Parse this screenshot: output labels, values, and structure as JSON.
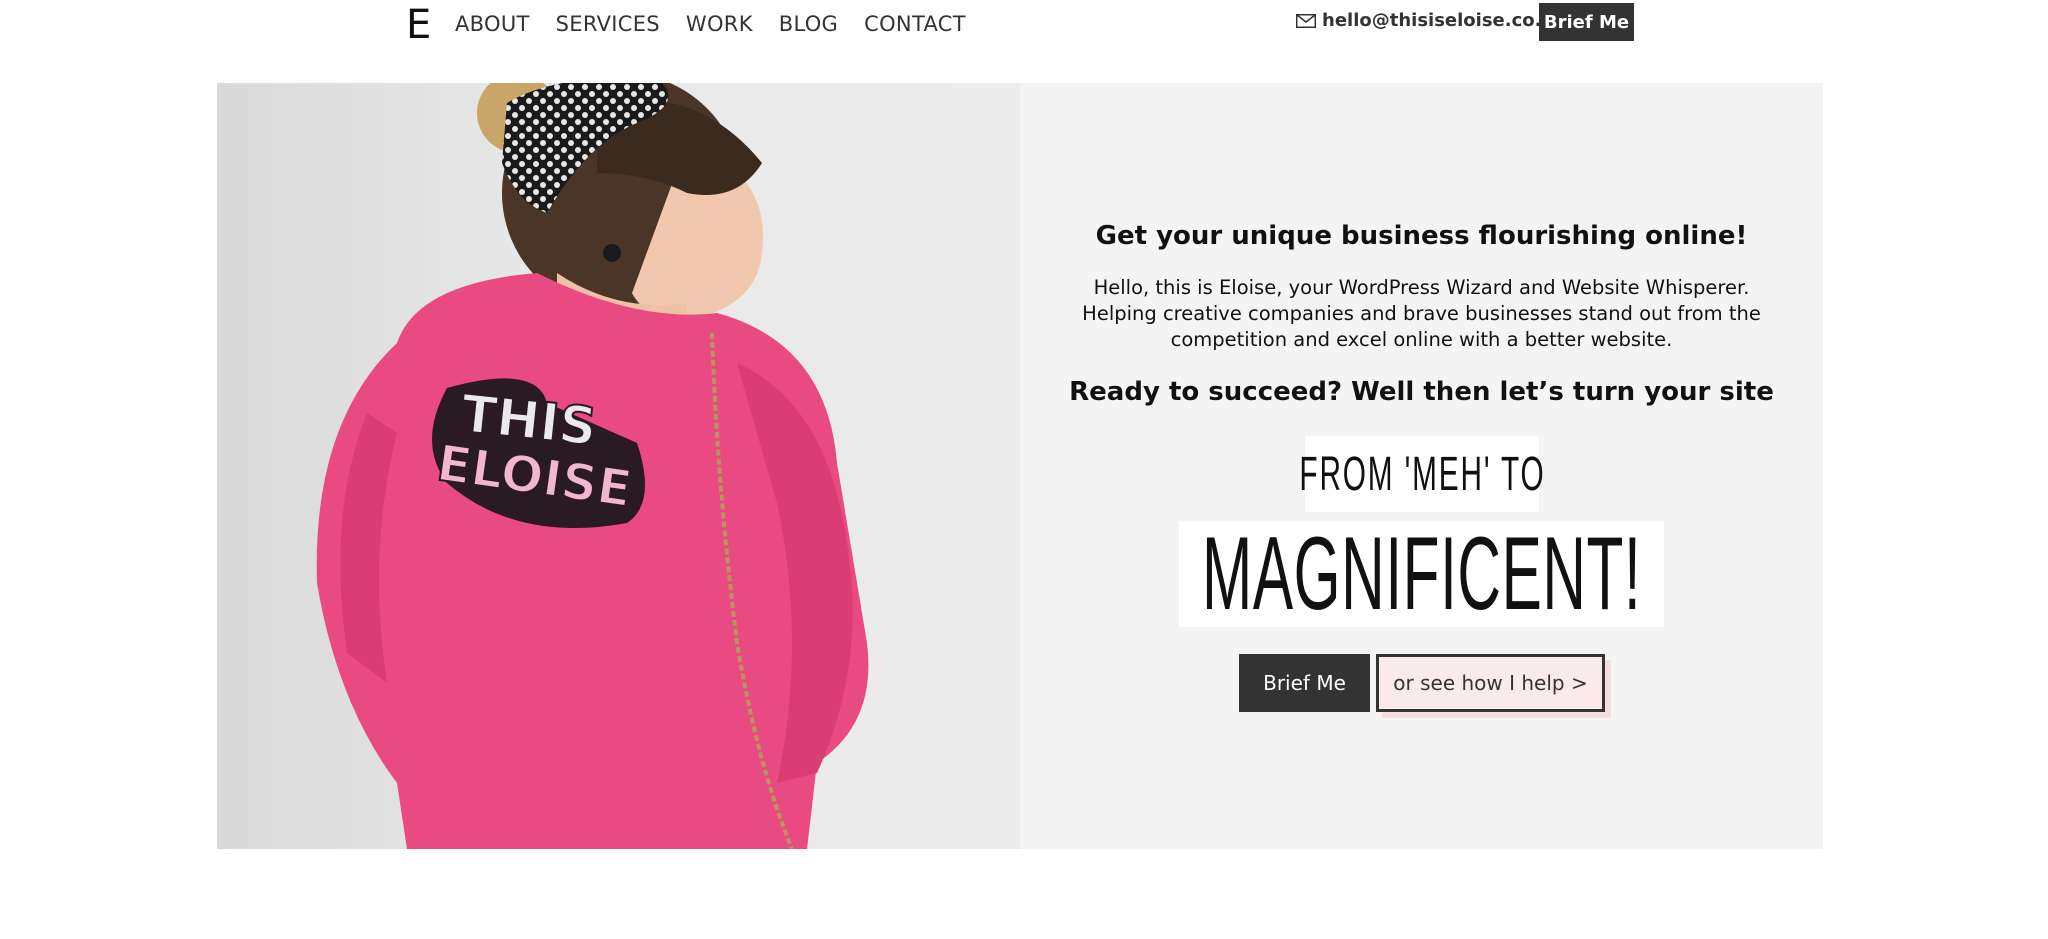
{
  "header": {
    "logo": "E",
    "nav": [
      "ABOUT",
      "SERVICES",
      "WORK",
      "BLOG",
      "CONTACT"
    ],
    "email": "hello@thisiseloise.co.uk",
    "brief_label": "Brief Me"
  },
  "hero": {
    "tagline": "Get your unique business flourishing online!",
    "intro": "Hello, this is Eloise, your WordPress Wizard and Website Whisperer. Helping creative companies and brave businesses stand out from the competition and excel online with a better website.",
    "ready": "Ready to succeed? Well then let’s turn your site",
    "from_text": "FROM 'MEH' TO",
    "magnificent": "MAGNIFICENT!",
    "brief_button": "Brief Me",
    "help_button": "or see how I help >",
    "patch_line1": "THIS",
    "patch_line2": "ELOISE"
  },
  "colors": {
    "dark_button": "#333333",
    "panel_bg": "#f4f4f4",
    "jacket_pink": "#e94a82",
    "help_button_bg": "#fbeaea"
  }
}
